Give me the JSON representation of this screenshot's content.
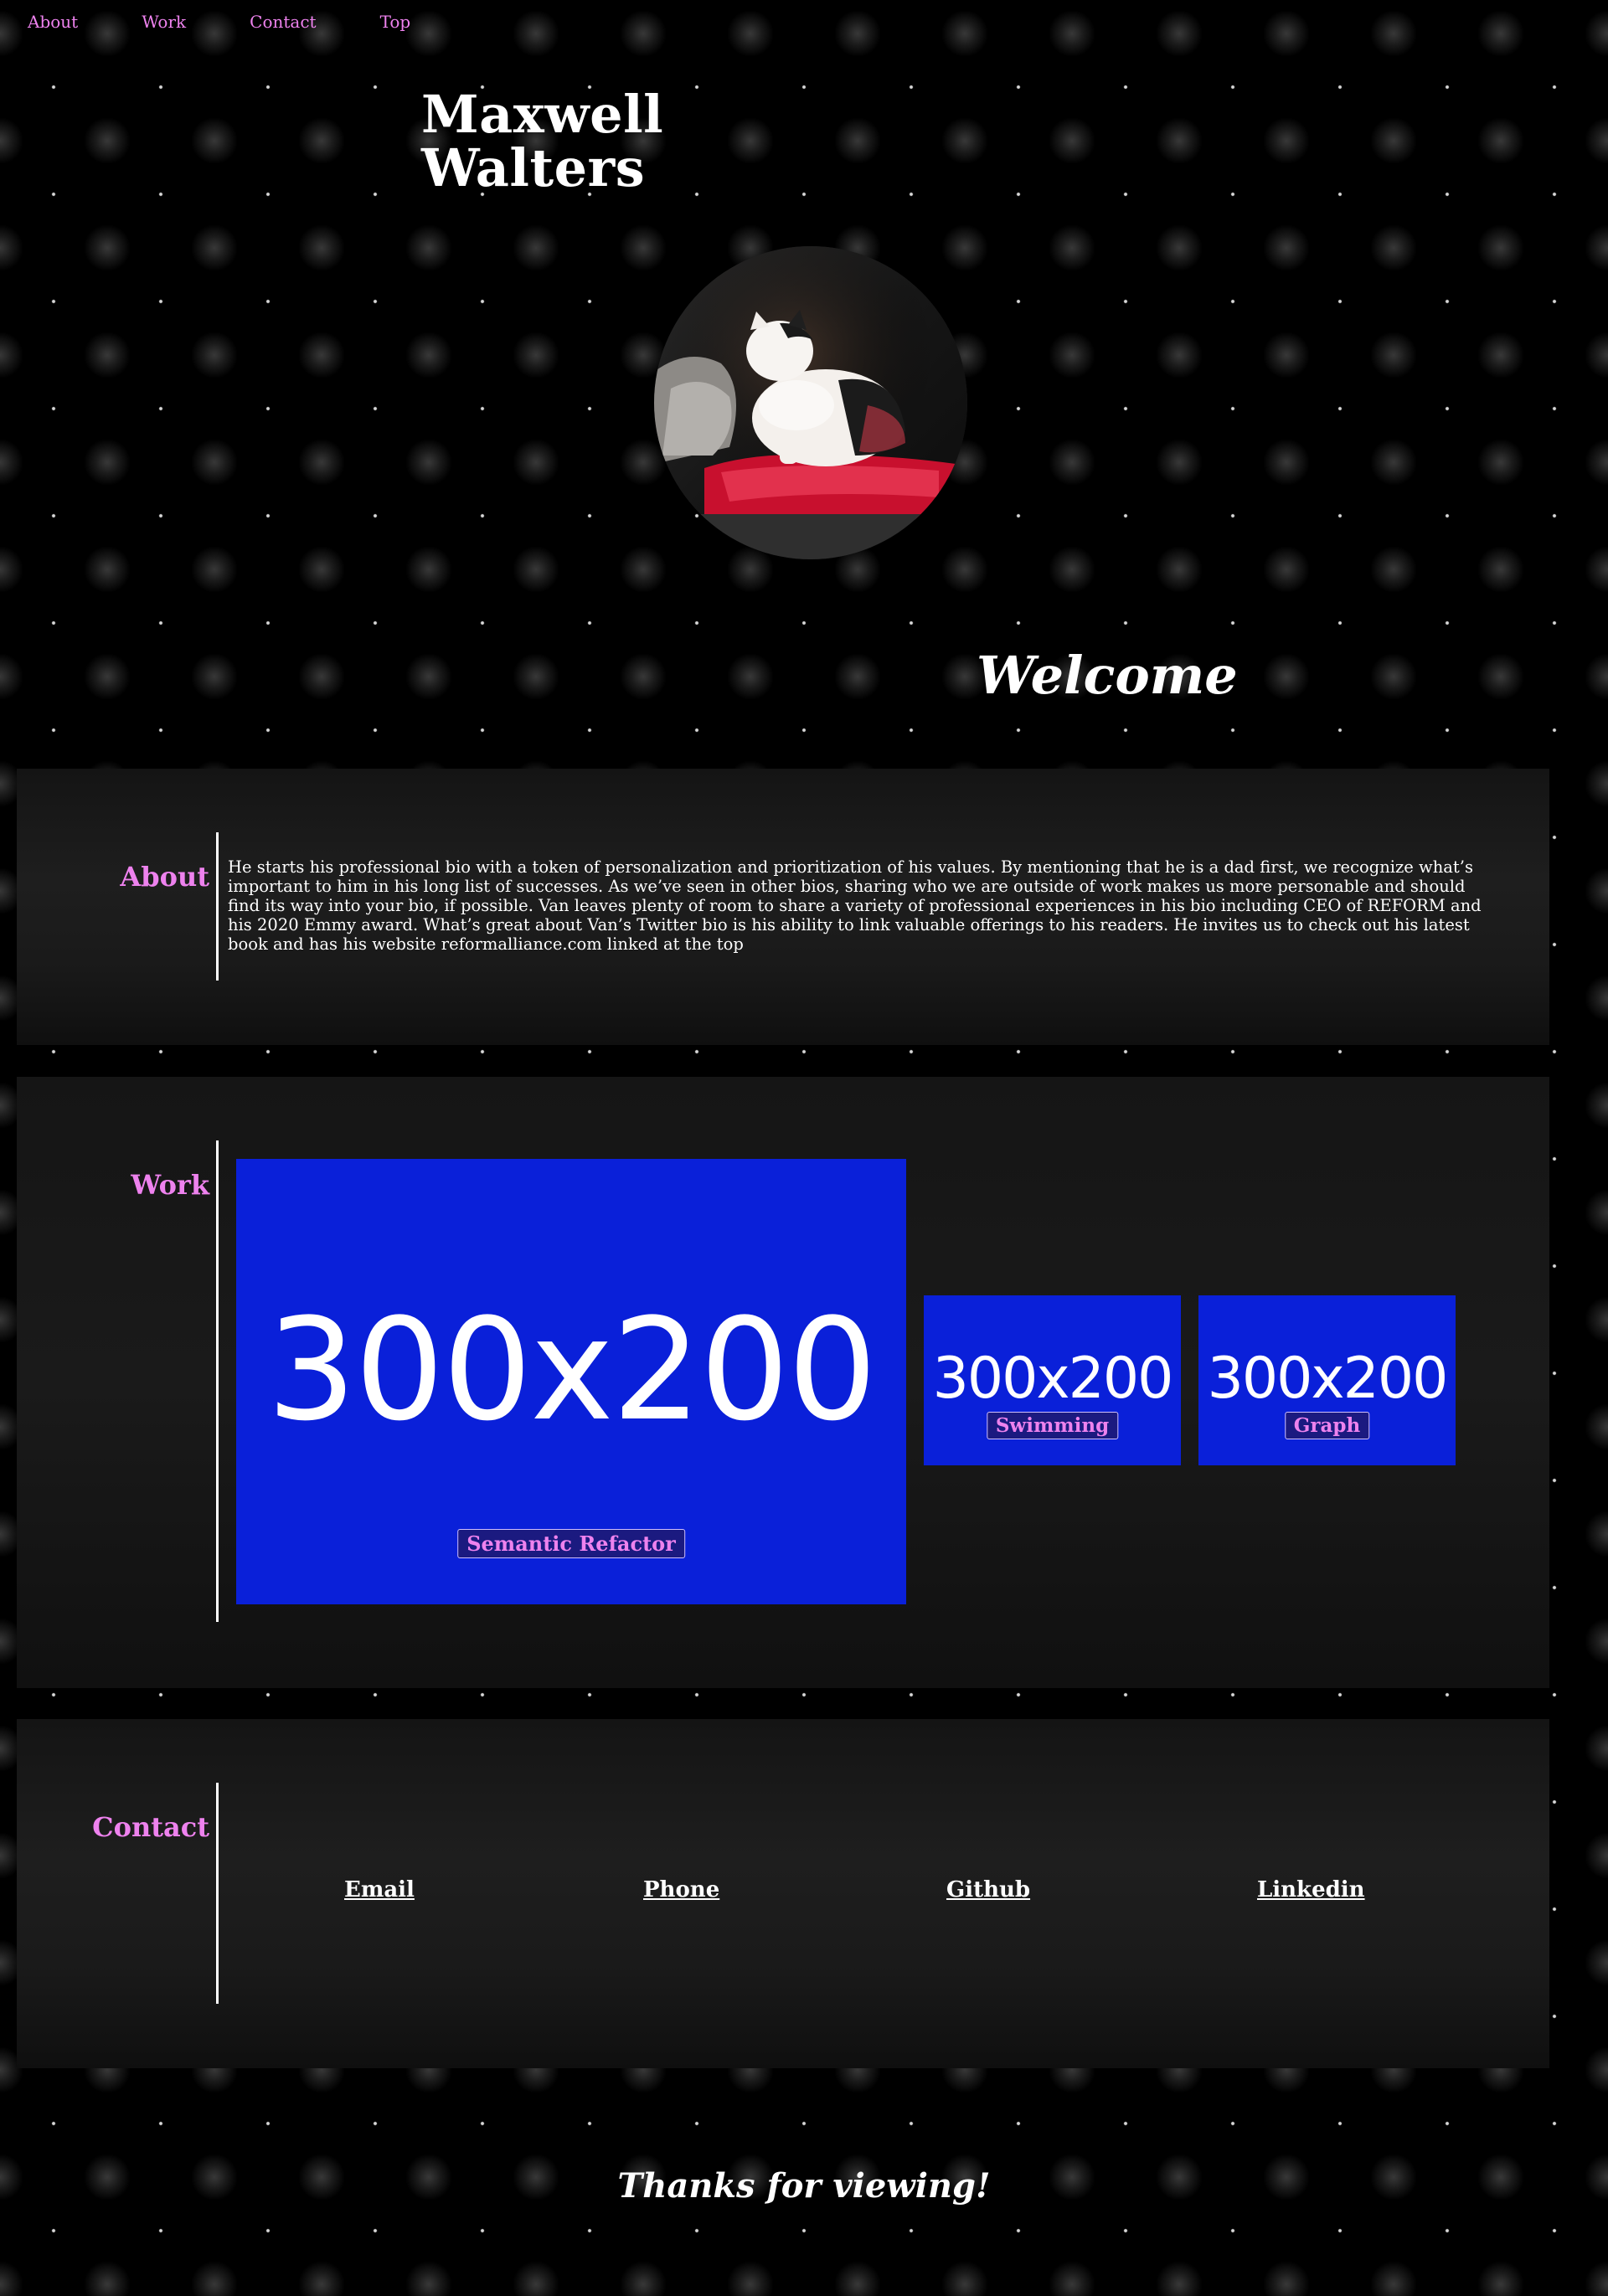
{
  "nav": {
    "items": [
      {
        "label": "About"
      },
      {
        "label": "Work"
      },
      {
        "label": "Contact"
      },
      {
        "label": "Top"
      }
    ]
  },
  "header": {
    "name_line1": "Maxwell",
    "name_line2": "Walters",
    "welcome": "Welcome"
  },
  "about": {
    "title": "About",
    "body": "He starts his professional bio with a token of personalization and prioritization of his values. By mentioning that he is a dad first, we recognize what’s important to him in his long list of successes. As we’ve seen in other bios, sharing who we are outside of work makes us more personable and should find its way into your bio, if possible. Van leaves plenty of room to share a variety of professional experiences in his bio including CEO of REFORM and his 2020 Emmy award. What’s great about Van’s Twitter bio is his ability to link valuable offerings to his readers. He invites us to check out his latest book and has his website reformalliance.com linked at the top"
  },
  "work": {
    "title": "Work",
    "projects": [
      {
        "placeholder": "300x200",
        "label": "Semantic Refactor"
      },
      {
        "placeholder": "300x200",
        "label": "Swimming"
      },
      {
        "placeholder": "300x200",
        "label": "Graph"
      }
    ]
  },
  "contact": {
    "title": "Contact",
    "links": [
      {
        "label": "Email"
      },
      {
        "label": "Phone"
      },
      {
        "label": "Github"
      },
      {
        "label": "Linkedin"
      }
    ]
  },
  "footer": {
    "thanks": "Thanks for viewing!"
  },
  "colors": {
    "accent": "#ee82ee",
    "tile_blue": "#0a20d9",
    "background": "#000000"
  }
}
